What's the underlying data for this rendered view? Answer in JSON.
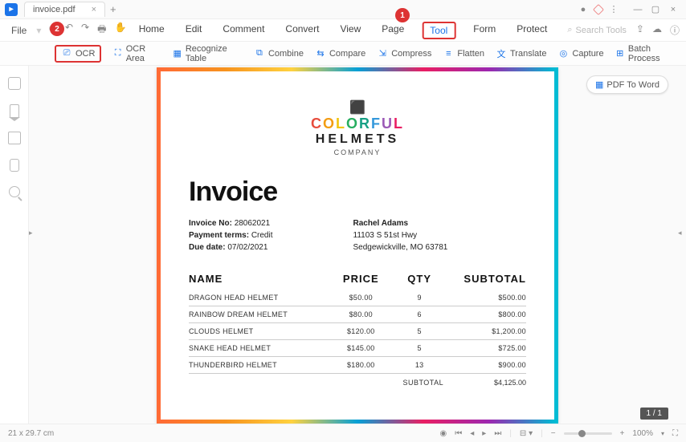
{
  "titlebar": {
    "tab_name": "invoice.pdf",
    "app_glyph": "▸"
  },
  "menubar": {
    "file": "File",
    "items": [
      "Home",
      "Edit",
      "Comment",
      "Convert",
      "View",
      "Page",
      "Tool",
      "Form",
      "Protect"
    ],
    "active_index": 6,
    "search_placeholder": "Search Tools"
  },
  "toolbar": {
    "ocr": "OCR",
    "ocr_area": "OCR Area",
    "recognize_table": "Recognize Table",
    "combine": "Combine",
    "compare": "Compare",
    "compress": "Compress",
    "flatten": "Flatten",
    "translate": "Translate",
    "capture": "Capture",
    "batch_process": "Batch Process"
  },
  "badges": {
    "b1": "1",
    "b2": "2"
  },
  "floating": {
    "pdf_to_word": "PDF To Word"
  },
  "statusbar": {
    "page_size": "21 x 29.7 cm",
    "zoom": "100%",
    "page_indicator": "1 / 1"
  },
  "document": {
    "logo": {
      "line1_html": "COLORFUL",
      "line2": "HELMETS",
      "line3": "COMPANY"
    },
    "title": "Invoice",
    "meta": {
      "invoice_no_label": "Invoice No:",
      "invoice_no": "28062021",
      "payment_terms_label": "Payment terms:",
      "payment_terms": "Credit",
      "due_date_label": "Due date:",
      "due_date": "07/02/2021",
      "client_name": "Rachel Adams",
      "client_addr1": "11103 S 51st Hwy",
      "client_addr2": "Sedgewickville, MO 63781"
    },
    "table": {
      "headers": {
        "name": "NAME",
        "price": "PRICE",
        "qty": "QTY",
        "subtotal": "SUBTOTAL"
      },
      "rows": [
        {
          "name": "DRAGON HEAD HELMET",
          "price": "$50.00",
          "qty": "9",
          "subtotal": "$500.00"
        },
        {
          "name": "RAINBOW DREAM HELMET",
          "price": "$80.00",
          "qty": "6",
          "subtotal": "$800.00"
        },
        {
          "name": "CLOUDS HELMET",
          "price": "$120.00",
          "qty": "5",
          "subtotal": "$1,200.00"
        },
        {
          "name": "SNAKE HEAD HELMET",
          "price": "$145.00",
          "qty": "5",
          "subtotal": "$725.00"
        },
        {
          "name": "THUNDERBIRD HELMET",
          "price": "$180.00",
          "qty": "13",
          "subtotal": "$900.00"
        }
      ],
      "subtotal_label": "SUBTOTAL",
      "subtotal_value": "$4,125.00"
    }
  }
}
